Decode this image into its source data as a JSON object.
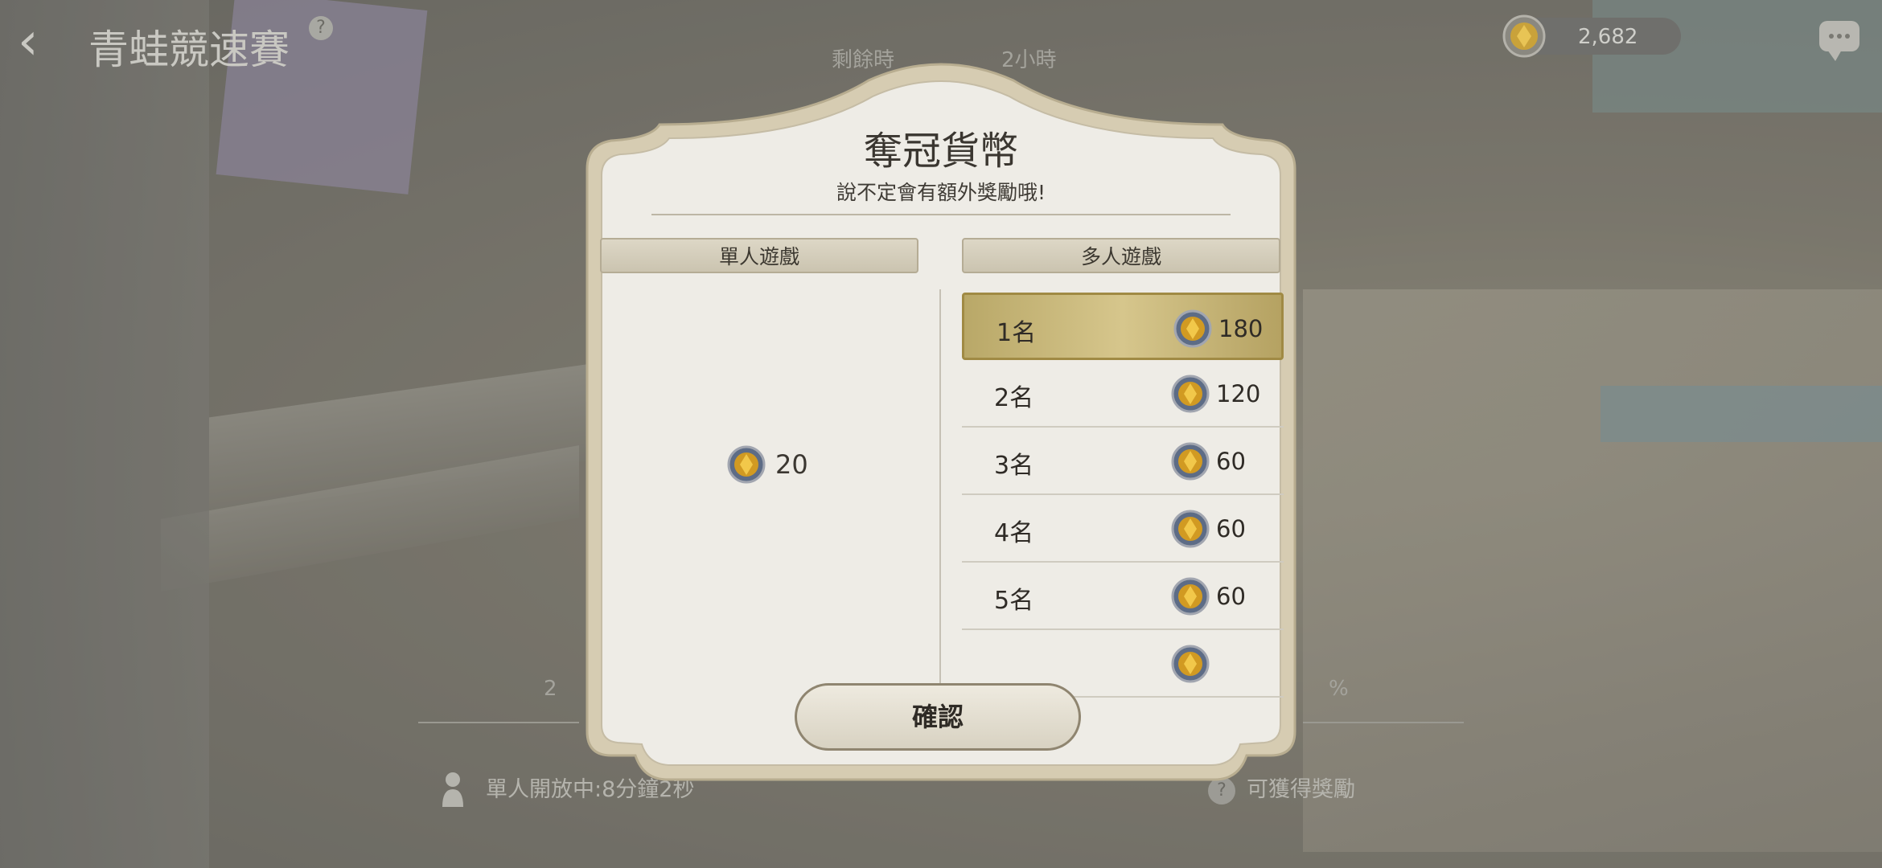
{
  "header": {
    "back_label": "‹",
    "title": "青蛙競速賽",
    "help": "?",
    "currency_amount": "2,682",
    "currency_icon": "gem-coin-icon",
    "chat_icon": "chat-icon"
  },
  "background": {
    "remaining_text": "剩餘時",
    "hours_text": "2小時",
    "left_pct": "2",
    "right_pct": "%",
    "solo_status": "單人開放中:8分鐘2秒",
    "reward_link": "可獲得獎勵"
  },
  "dialog": {
    "title": "奪冠貨幣",
    "subtitle": "說不定會有額外獎勵哦!",
    "single_header": "單人遊戲",
    "multi_header": "多人遊戲",
    "single_reward": "20",
    "multi_rewards": [
      {
        "rank": "1名",
        "amount": "180"
      },
      {
        "rank": "2名",
        "amount": "120"
      },
      {
        "rank": "3名",
        "amount": "60"
      },
      {
        "rank": "4名",
        "amount": "60"
      },
      {
        "rank": "5名",
        "amount": "60"
      }
    ],
    "confirm_label": "確認",
    "colors": {
      "highlight": "#c9b878",
      "frame": "#d8cfb8",
      "panel": "#f0eee8"
    }
  }
}
